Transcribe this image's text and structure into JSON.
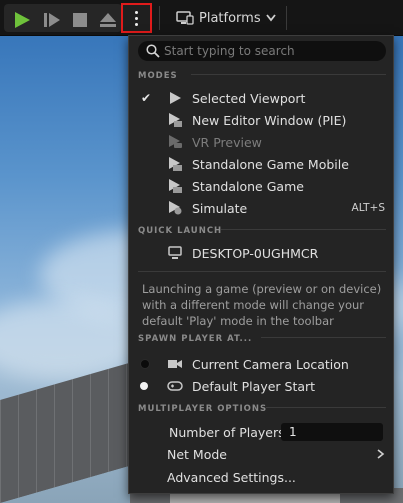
{
  "toolbar": {
    "platforms_label": "Platforms",
    "play_color": "#6fc23b"
  },
  "menu": {
    "search": {
      "placeholder": "Start typing to search"
    },
    "modes": {
      "header": "MODES",
      "items": [
        {
          "label": "Selected Viewport",
          "checked": true,
          "icon": "play-icon"
        },
        {
          "label": "New Editor Window (PIE)",
          "icon": "editor-window-icon"
        },
        {
          "label": "VR Preview",
          "disabled": true,
          "icon": "vr-icon"
        },
        {
          "label": "Standalone Game Mobile",
          "icon": "standalone-icon"
        },
        {
          "label": "Standalone Game",
          "icon": "standalone-icon"
        },
        {
          "label": "Simulate",
          "icon": "simulate-icon",
          "shortcut": "ALT+S"
        }
      ]
    },
    "quick_launch": {
      "header": "QUICK LAUNCH",
      "device": "DESKTOP-0UGHMCR"
    },
    "description": "Launching a game (preview or on device) with a different mode will change your default 'Play' mode in the toolbar",
    "spawn": {
      "header": "SPAWN PLAYER AT...",
      "items": [
        {
          "label": "Current Camera Location",
          "icon": "camera-icon",
          "selected": false
        },
        {
          "label": "Default Player Start",
          "icon": "gamepad-icon",
          "selected": true
        }
      ]
    },
    "multiplayer": {
      "header": "MULTIPLAYER OPTIONS",
      "players_label": "Number of Players",
      "players_value": "1",
      "net_mode_label": "Net Mode",
      "advanced_label": "Advanced Settings..."
    }
  }
}
